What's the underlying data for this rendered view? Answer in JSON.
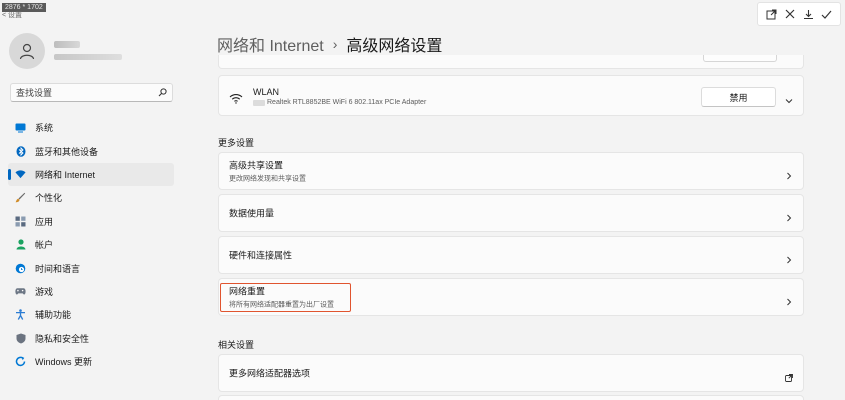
{
  "overlay": {
    "dimensions": "2876 * 1702",
    "back": "<",
    "back_label": "设置"
  },
  "tools": {
    "icons": [
      "expand-icon",
      "close-icon",
      "download-icon",
      "check-icon"
    ]
  },
  "sidebar": {
    "search": {
      "placeholder": "查找设置"
    },
    "items": [
      {
        "label": "系统",
        "icon": "monitor-icon",
        "color": "#0078d4"
      },
      {
        "label": "蓝牙和其他设备",
        "icon": "bluetooth-icon",
        "color": "#0067c0"
      },
      {
        "label": "网络和 Internet",
        "icon": "wifi-icon",
        "color": "#0067c0",
        "active": true
      },
      {
        "label": "个性化",
        "icon": "brush-icon",
        "color": "#d08b26"
      },
      {
        "label": "应用",
        "icon": "apps-icon",
        "color": "#5a6a80"
      },
      {
        "label": "帐户",
        "icon": "person-icon",
        "color": "#1aa260"
      },
      {
        "label": "时间和语言",
        "icon": "globe-clock-icon",
        "color": "#0078d4"
      },
      {
        "label": "游戏",
        "icon": "gamepad-icon",
        "color": "#6d7785"
      },
      {
        "label": "辅助功能",
        "icon": "accessibility-icon",
        "color": "#2b7cd3"
      },
      {
        "label": "隐私和安全性",
        "icon": "shield-icon",
        "color": "#6b7380"
      },
      {
        "label": "Windows 更新",
        "icon": "update-icon",
        "color": "#0078d4"
      }
    ]
  },
  "breadcrumb": {
    "parent": "网络和 Internet",
    "separator": "›",
    "current": "高级网络设置"
  },
  "wlan": {
    "title": "WLAN",
    "adapter": "Realtek RTL8852BE WiFi 6 802.11ax PCIe Adapter",
    "button": "禁用"
  },
  "more_settings": {
    "title": "更多设置",
    "items": [
      {
        "title": "高级共享设置",
        "subtitle": "更改网络发现和共享设置"
      },
      {
        "title": "数据使用量",
        "subtitle": ""
      },
      {
        "title": "硬件和连接属性",
        "subtitle": ""
      },
      {
        "title": "网络重置",
        "subtitle": "将所有网络适配器重置为出厂设置"
      }
    ]
  },
  "related": {
    "title": "相关设置",
    "items": [
      {
        "title": "更多网络适配器选项"
      }
    ]
  },
  "colors": {
    "accent": "#0067c0",
    "highlight": "#e0542f"
  }
}
